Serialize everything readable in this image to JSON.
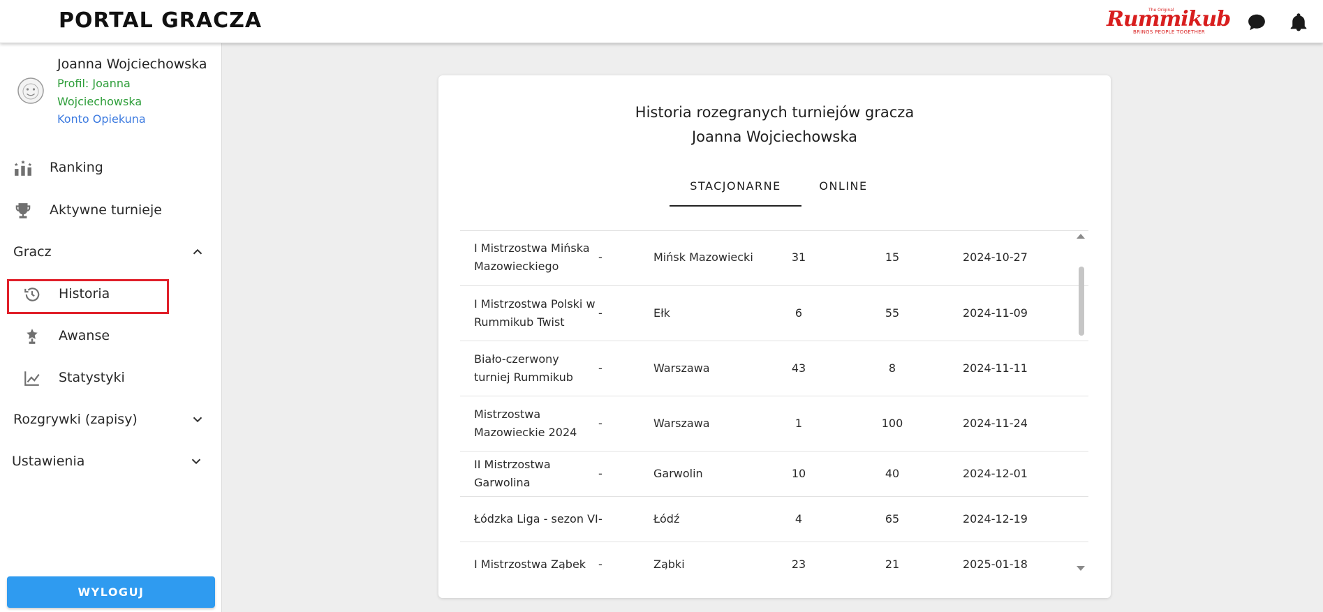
{
  "header": {
    "brand": "PORTAL GRACZA",
    "logo": {
      "word": "Rummikub",
      "small": "The Original",
      "tagline": "BRINGS PEOPLE TOGETHER"
    },
    "icons": [
      "chat-icon",
      "bell-icon"
    ]
  },
  "sidebar": {
    "user_name": "Joanna Wojciechowska",
    "profile_link": "Profil: Joanna Wojciechowska",
    "account_link": "Konto Opiekuna",
    "items": [
      {
        "label": "Ranking",
        "icon": "ranking-icon"
      },
      {
        "label": "Aktywne turnieje",
        "icon": "trophy-icon"
      },
      {
        "label": "Gracz",
        "expanded": true
      },
      {
        "label": "Historia",
        "icon": "history-icon",
        "selected": true
      },
      {
        "label": "Awanse",
        "icon": "award-icon"
      },
      {
        "label": "Statystyki",
        "icon": "chart-icon"
      },
      {
        "label": "Rozgrywki (zapisy)",
        "expanded": false
      },
      {
        "label": "Ustawienia",
        "expanded": false
      }
    ],
    "logout_label": "WYLOGUJ"
  },
  "main": {
    "title_line1": "Historia rozegranych turniejów gracza",
    "title_line2": "Joanna Wojciechowska",
    "tabs": [
      {
        "label": "STACJONARNE",
        "active": true
      },
      {
        "label": "ONLINE",
        "active": false
      }
    ],
    "rows": [
      {
        "name": "I Mistrzostwa Mińska Mazowieckiego",
        "dash": "-",
        "city": "Mińsk Mazowiecki",
        "n1": "31",
        "n2": "15",
        "date": "2024-10-27"
      },
      {
        "name": "I Mistrzostwa Polski w Rummikub Twist",
        "dash": "-",
        "city": "Ełk",
        "n1": "6",
        "n2": "55",
        "date": "2024-11-09"
      },
      {
        "name": "Biało-czerwony turniej Rummikub",
        "dash": "-",
        "city": "Warszawa",
        "n1": "43",
        "n2": "8",
        "date": "2024-11-11"
      },
      {
        "name": "Mistrzostwa Mazowieckie 2024",
        "dash": "-",
        "city": "Warszawa",
        "n1": "1",
        "n2": "100",
        "date": "2024-11-24"
      },
      {
        "name": "II Mistrzostwa Garwolina",
        "dash": "-",
        "city": "Garwolin",
        "n1": "10",
        "n2": "40",
        "date": "2024-12-01"
      },
      {
        "name": "Łódzka Liga - sezon VI",
        "dash": "-",
        "city": "Łódź",
        "n1": "4",
        "n2": "65",
        "date": "2024-12-19"
      },
      {
        "name": "I Mistrzostwa Ząbek",
        "dash": "-",
        "city": "Ząbki",
        "n1": "23",
        "n2": "21",
        "date": "2025-01-18"
      }
    ]
  },
  "colors": {
    "logout": "#2f9bf0",
    "profile_link": "#2e9e3a",
    "account_link": "#3d7be0",
    "highlight": "#e0202a",
    "logo_red": "#d81e1e"
  }
}
